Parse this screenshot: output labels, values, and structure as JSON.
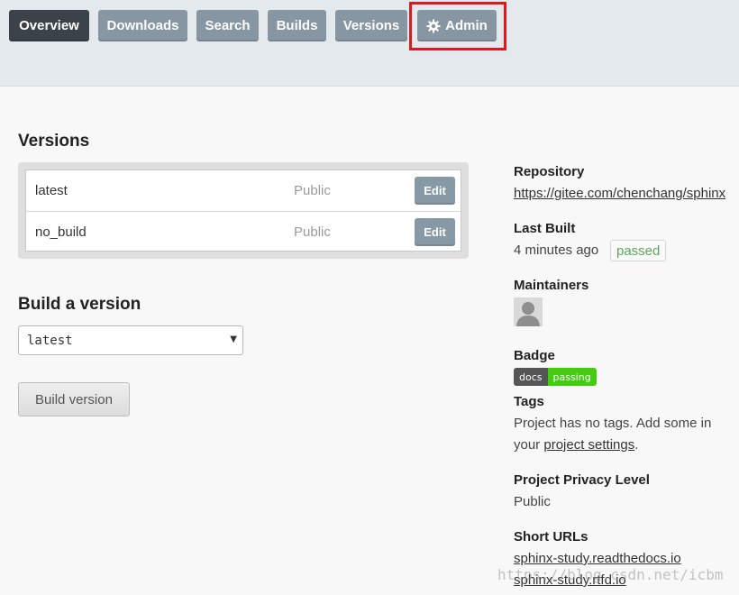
{
  "nav": {
    "overview": "Overview",
    "downloads": "Downloads",
    "search": "Search",
    "builds": "Builds",
    "versions": "Versions",
    "admin": "Admin",
    "active_tab": "Overview",
    "admin_icon": "gear-icon",
    "active_color": "#3b4349",
    "inactive_color": "#8796a3",
    "highlight_color": "#e0191f"
  },
  "versions": {
    "heading": "Versions",
    "rows": [
      {
        "name": "latest",
        "privacy": "Public",
        "edit": "Edit"
      },
      {
        "name": "no_build",
        "privacy": "Public",
        "edit": "Edit"
      }
    ]
  },
  "build": {
    "heading": "Build a version",
    "selected": "latest",
    "button": "Build version"
  },
  "sidebar": {
    "repository": {
      "heading": "Repository",
      "url": "https://gitee.com/chenchang/sphinx"
    },
    "last_built": {
      "heading": "Last Built",
      "time": "4 minutes ago",
      "status": "passed",
      "status_color": "#5aa85a"
    },
    "maintainers": {
      "heading": "Maintainers",
      "avatar_icon": "user-silhouette-icon"
    },
    "badge": {
      "heading": "Badge",
      "left": "docs",
      "right": "passing",
      "right_color": "#44cc11"
    },
    "tags": {
      "heading": "Tags",
      "line1": "Project has no tags. Add some in",
      "line2_prefix": "your ",
      "link": "project settings",
      "line2_suffix": "."
    },
    "privacy": {
      "heading": "Project Privacy Level",
      "value": "Public"
    },
    "short_urls": {
      "heading": "Short URLs",
      "url1": "sphinx-study.readthedocs.io",
      "url2": "sphinx-study.rtfd.io"
    }
  },
  "watermark": "https://blog.csdn.net/icbm"
}
